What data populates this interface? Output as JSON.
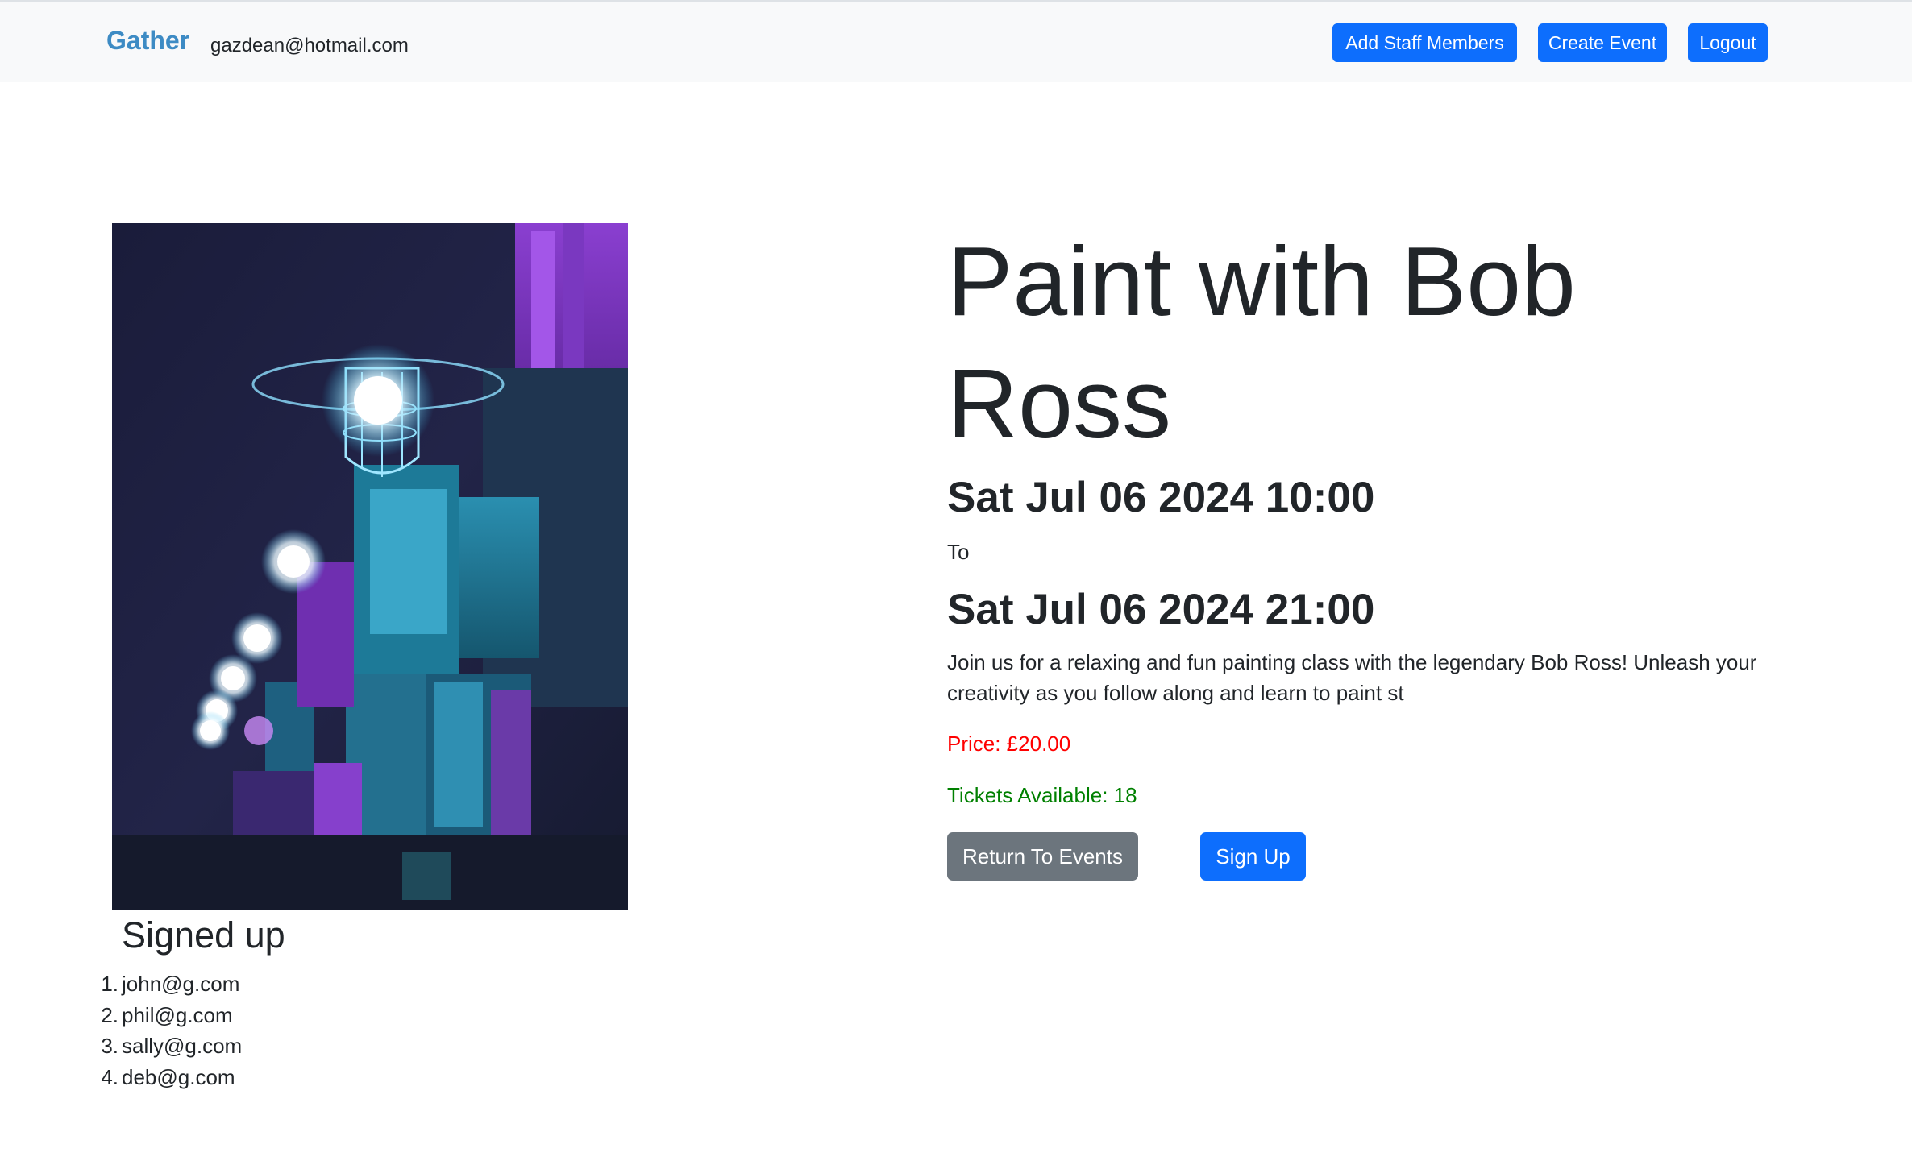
{
  "navbar": {
    "brand": "Gather",
    "user_email": "gazdean@hotmail.com",
    "add_staff_label": "Add Staff Members",
    "create_event_label": "Create Event",
    "logout_label": "Logout"
  },
  "event": {
    "title": "Paint with Bob Ross",
    "start": "Sat Jul 06 2024 10:00",
    "to_label": "To",
    "end": "Sat Jul 06 2024 21:00",
    "description": "Join us for a relaxing and fun painting class with the legendary Bob Ross! Unleash your creativity as you follow along and learn to paint st",
    "price": "Price: £20.00",
    "tickets": "Tickets Available: 18",
    "return_label": "Return To Events",
    "signup_label": "Sign Up"
  },
  "signed_up": {
    "heading": "Signed up",
    "attendees": [
      {
        "num": "1.",
        "email": "john@g.com"
      },
      {
        "num": "2.",
        "email": "phil@g.com"
      },
      {
        "num": "3.",
        "email": "sally@g.com"
      },
      {
        "num": "4.",
        "email": "deb@g.com"
      }
    ]
  },
  "colors": {
    "primary": "#0d6efd",
    "secondary": "#6c757d",
    "price": "#ff0000",
    "tickets": "#008000",
    "brand": "#3d8bc4"
  }
}
